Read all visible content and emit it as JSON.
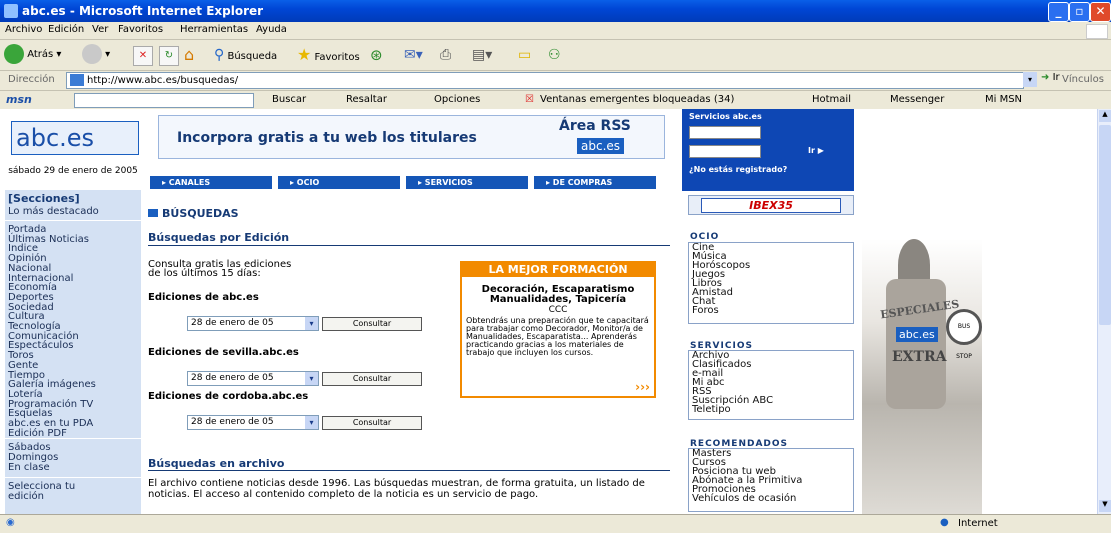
{
  "window": {
    "title": "abc.es - Microsoft Internet Explorer"
  },
  "menu": [
    "Archivo",
    "Edición",
    "Ver",
    "Favoritos",
    "Herramientas",
    "Ayuda"
  ],
  "toolbar": {
    "back": "Atrás",
    "search": "Búsqueda",
    "favorites": "Favoritos"
  },
  "address": {
    "label": "Dirección",
    "url": "http://www.abc.es/busquedas/",
    "go": "Ir",
    "links": "Vínculos"
  },
  "msn": {
    "logo": "msn",
    "search": "Buscar",
    "highlight": "Resaltar",
    "options": "Opciones",
    "popups": "Ventanas emergentes bloqueadas (34)",
    "hotmail": "Hotmail",
    "messenger": "Messenger",
    "mymsn": "Mi MSN"
  },
  "page": {
    "logo": "abc.es",
    "date": "sábado 29 de enero de 2005",
    "banner": {
      "text": "Incorpora gratis a tu web los titulares",
      "rss_title": "Área RSS",
      "rss_badge": "abc.es"
    },
    "services_box": {
      "title": "Servicios abc.es",
      "go": "Ir ▶",
      "register": "¿No estás registrado?"
    },
    "nav_tabs": [
      "▸ CANALES",
      "▸ OCIO",
      "▸ SERVICIOS",
      "▸ DE COMPRAS"
    ],
    "sections_title": "[Secciones]",
    "featured": "Lo más destacado",
    "sidebar_links": [
      "Portada",
      "Últimas Noticias",
      "Indice",
      "Opinión",
      "Nacional",
      "Internacional",
      "Economía",
      "Deportes",
      "Sociedad",
      "Cultura",
      "Tecnología",
      "Comunicación",
      "Espectáculos",
      "Toros",
      "Gente",
      "Tiempo",
      "Galería imágenes",
      "Lotería",
      "Programación TV",
      "Esquelas",
      "abc.es en tu PDA",
      "Edición PDF"
    ],
    "sidebar_extra": [
      "Sábados",
      "Domingos",
      "En clase"
    ],
    "sidebar_select": "Selecciona tu edición",
    "section_title": "BÚSQUEDAS",
    "edition_title": "Búsquedas por Edición",
    "edition_intro": "Consulta gratis las ediciones de los últimos 15 días:",
    "editions": [
      {
        "label": "Ediciones de abc.es",
        "date": "28 de enero de 05",
        "button": "Consultar"
      },
      {
        "label": "Ediciones de sevilla.abc.es",
        "date": "28 de enero de 05",
        "button": "Consultar"
      },
      {
        "label": "Ediciones de cordoba.abc.es",
        "date": "28 de enero de 05",
        "button": "Consultar"
      }
    ],
    "ad": {
      "header": "LA MEJOR FORMACIÓN",
      "title": "Decoración, Escaparatismo Manualidades, Tapicería",
      "sub": "CCC",
      "text": "Obtendrás una preparación que te capacitará para trabajar como Decorador, Monitor/a de Manualidades, Escaparatista... Aprenderás practicando gracias a los materiales de trabajo que incluyen los cursos.",
      "arrows": "›››"
    },
    "archive_title": "Búsquedas en archivo",
    "archive_text": "El archivo contiene noticias desde 1996. Las búsquedas muestran, de forma gratuita, un listado de noticias. El acceso al contenido completo de la noticia es un servicio de pago.",
    "ibex": "IBEX35",
    "ocio": {
      "title": "OCIO",
      "items": [
        "Cine",
        "Música",
        "Horóscopos",
        "Juegos",
        "Libros",
        "Amistad",
        "Chat",
        "Foros"
      ]
    },
    "servicios": {
      "title": "SERVICIOS",
      "items": [
        "Archivo",
        "Clasificados",
        "e-mail",
        "Mi abc",
        "RSS",
        "Suscripción ABC",
        "Teletipo"
      ]
    },
    "recomendados": {
      "title": "RECOMENDADOS",
      "items": [
        "Masters",
        "Cursos",
        "Posiciona tu web",
        "Abónate a la Primitiva",
        "Promociones",
        "Vehículos de ocasión"
      ]
    },
    "specials": {
      "line1": "ESPECIALES",
      "badge": "abc.es",
      "line2": "EXTRA",
      "sign": "BUS STOP"
    }
  },
  "status": {
    "zone": "Internet"
  }
}
